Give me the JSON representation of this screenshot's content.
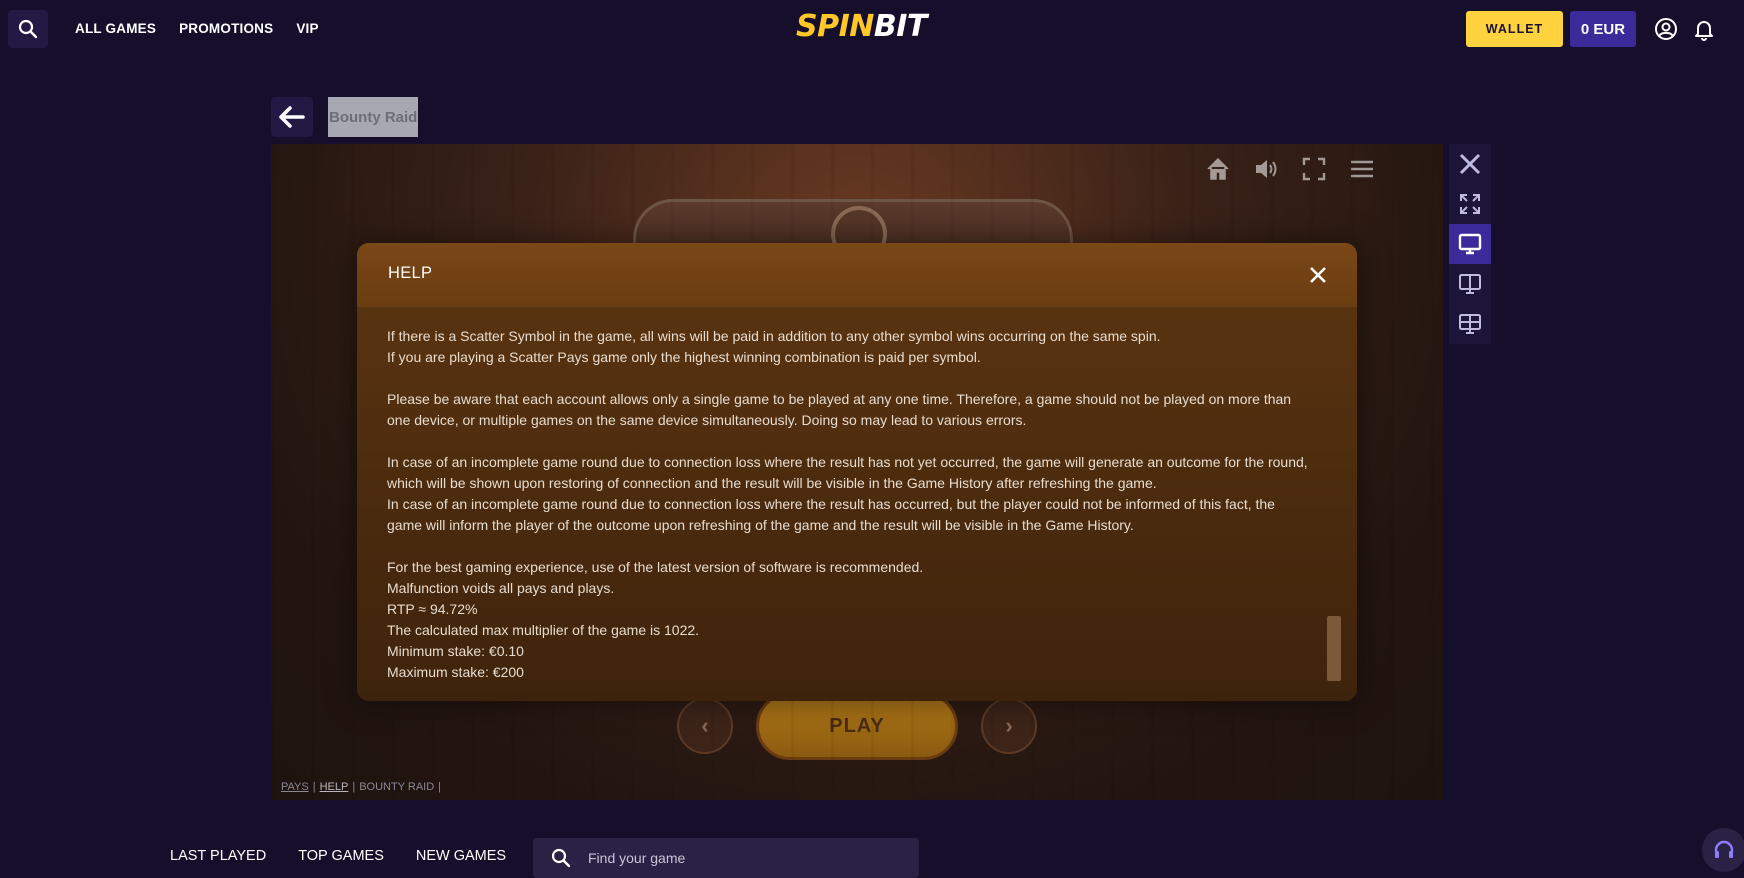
{
  "header": {
    "nav": [
      "ALL GAMES",
      "PROMOTIONS",
      "VIP"
    ],
    "logo_spin": "SPIN",
    "logo_bit": "BIT",
    "wallet_label": "WALLET",
    "balance": "0 EUR"
  },
  "game": {
    "title": "Bounty Raid",
    "play_label": "PLAY",
    "links": [
      "PAYS",
      "HELP",
      "BOUNTY RAID"
    ]
  },
  "help_modal": {
    "title": "HELP",
    "paragraphs": [
      [
        "If there is a Scatter Symbol in the game, all wins will be paid in addition to any other symbol wins occurring on the same spin.",
        "If you are playing a Scatter Pays game only the highest winning combination is paid per symbol."
      ],
      [
        "Please be aware that each account allows only a single game to be played at any one time. Therefore, a game should not be played on more than one device, or multiple games on the same device simultaneously. Doing so may lead to various errors."
      ],
      [
        "In case of an incomplete game round due to connection loss where the result has not yet occurred, the game will generate an outcome for the round, which will be shown upon restoring of connection and the result will be visible in the Game History after refreshing the game.",
        "In case of an incomplete game round due to connection loss where the result has occurred, but the player could not be informed of this fact, the game will inform the player of the outcome upon refreshing of the game and the result will be visible in the Game History."
      ],
      [
        "For the best gaming experience, use of the latest version of software is recommended.",
        "Malfunction voids all pays and plays.",
        "RTP ≈ 94.72%",
        "The calculated max multiplier of the game is 1022.",
        "Minimum stake: €0.10",
        "Maximum stake: €200"
      ]
    ]
  },
  "bottom": {
    "tabs": [
      "LAST PLAYED",
      "TOP GAMES",
      "NEW GAMES"
    ],
    "search_placeholder": "Find your game"
  },
  "colors": {
    "background": "#160f2b",
    "accent_yellow": "#ffd23f",
    "accent_purple": "#3a2a9a",
    "modal_brown": "#5d3611"
  }
}
